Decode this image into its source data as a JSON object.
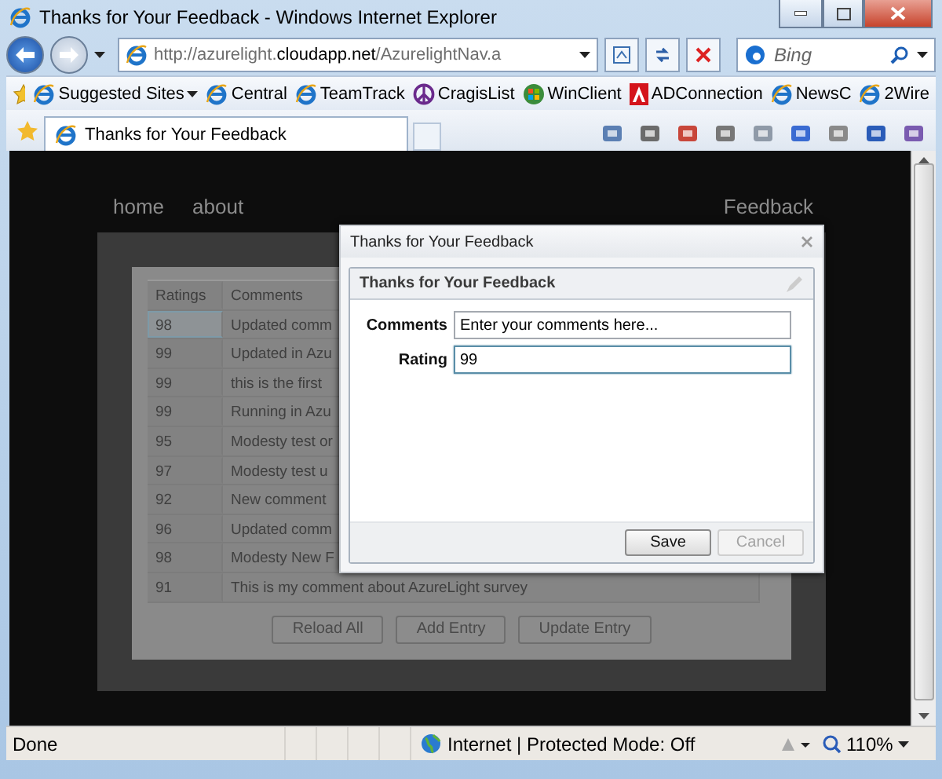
{
  "window": {
    "title": "Thanks for Your Feedback - Windows Internet Explorer"
  },
  "address_bar": {
    "url": "http://azurelight.**cloudapp.net**/AzurelightNav.a"
  },
  "search": {
    "placeholder": "Bing"
  },
  "favorites": [
    {
      "label": "Suggested Sites",
      "kind": "ie",
      "dropdown": true
    },
    {
      "label": "Central",
      "kind": "ie",
      "dropdown": false
    },
    {
      "label": "TeamTrack",
      "kind": "ie",
      "dropdown": false
    },
    {
      "label": "CragisList",
      "kind": "peace",
      "dropdown": false
    },
    {
      "label": "WinClient",
      "kind": "windows",
      "dropdown": false
    },
    {
      "label": "ADConnection",
      "kind": "adobe",
      "dropdown": false
    },
    {
      "label": "NewsC",
      "kind": "ie",
      "dropdown": false
    },
    {
      "label": "2Wire",
      "kind": "ie",
      "dropdown": false
    }
  ],
  "tabs": [
    {
      "label": "Thanks for Your Feedback",
      "selected": true
    }
  ],
  "nav": {
    "left": [
      "home",
      "about"
    ],
    "right": "Feedback"
  },
  "table": {
    "columns": [
      "Ratings",
      "Comments"
    ],
    "rows": [
      {
        "rating": "98",
        "comment": "Updated comm",
        "selected": true
      },
      {
        "rating": "99",
        "comment": "Updated in Azu",
        "selected": false
      },
      {
        "rating": "99",
        "comment": "this is the first",
        "selected": false
      },
      {
        "rating": "99",
        "comment": "Running in Azu",
        "selected": false
      },
      {
        "rating": "95",
        "comment": "Modesty test or",
        "selected": false
      },
      {
        "rating": "97",
        "comment": "Modesty test u",
        "selected": false
      },
      {
        "rating": "92",
        "comment": "New comment",
        "selected": false
      },
      {
        "rating": "96",
        "comment": "Updated comm",
        "selected": false
      },
      {
        "rating": "98",
        "comment": "Modesty New F",
        "selected": false
      },
      {
        "rating": "91",
        "comment": "This is my comment about AzureLight survey",
        "selected": false
      }
    ]
  },
  "page_buttons": [
    "Reload All",
    "Add Entry",
    "Update Entry"
  ],
  "dialog": {
    "title": "Thanks for Your Feedback",
    "panel_title": "Thanks for Your Feedback",
    "fields": [
      {
        "label": "Comments",
        "value": "Enter your comments here...",
        "focused": false
      },
      {
        "label": "Rating",
        "value": "99",
        "focused": true
      }
    ],
    "buttons": [
      {
        "label": "Save",
        "disabled": false
      },
      {
        "label": "Cancel",
        "disabled": true
      }
    ]
  },
  "status_bar": {
    "text": "Done",
    "zone": "Internet | Protected Mode: Off",
    "zoom": "110%"
  }
}
